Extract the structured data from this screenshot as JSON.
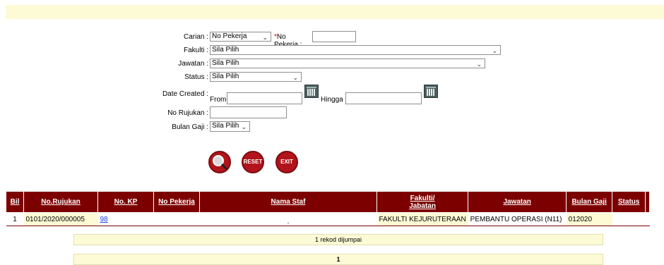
{
  "form": {
    "carian_label": "Carian :",
    "carian_value": "No Pekerja",
    "no_pekerja_label": "No Pekerja :",
    "no_pekerja_required": "*",
    "no_pekerja_value": "",
    "fakulti_label": "Fakulti :",
    "fakulti_value": "Sila Pilih",
    "jawatan_label": "Jawatan :",
    "jawatan_value": "Sila Pilih",
    "status_label": "Status :",
    "status_value": "Sila Pilih",
    "date_created_label": "Date Created :",
    "from_label": "From",
    "from_value": "",
    "hingga_label": "Hingga :",
    "hingga_value": "",
    "no_rujukan_label": "No Rujukan :",
    "no_rujukan_value": "",
    "bulan_gaji_label": "Bulan Gaji :",
    "bulan_gaji_value": "Sila Pilih"
  },
  "buttons": {
    "search_icon": "search-icon",
    "reset_label": "RESET",
    "exit_label": "EXIT"
  },
  "table": {
    "headers": [
      "Bil",
      "No.Rujukan",
      "No. KP",
      "No Pekerja",
      "Nama Staf",
      "Fakulti/ Jabatan",
      "Jawatan",
      "Bulan Gaji",
      "Status"
    ],
    "header_fakulti_line1": "Fakulti/",
    "header_fakulti_line2": "Jabatan",
    "rows": [
      {
        "bil": "1",
        "no_rujukan": "0101/2020/000005",
        "no_kp": "98",
        "no_pekerja": "",
        "nama_staf": ".",
        "fakulti": "FAKULTI KEJURUTERAAN",
        "jawatan": "PEMBANTU OPERASI (N11)",
        "bulan_gaji": "012020",
        "status": ""
      }
    ]
  },
  "footer": {
    "record_count": "1 rekod dijumpai",
    "page_number": "1"
  },
  "colors": {
    "header_bg": "#7d0000",
    "highlight_bg": "#fdfbd5",
    "button_red": "#b3141b",
    "link": "#1a3fd8"
  }
}
